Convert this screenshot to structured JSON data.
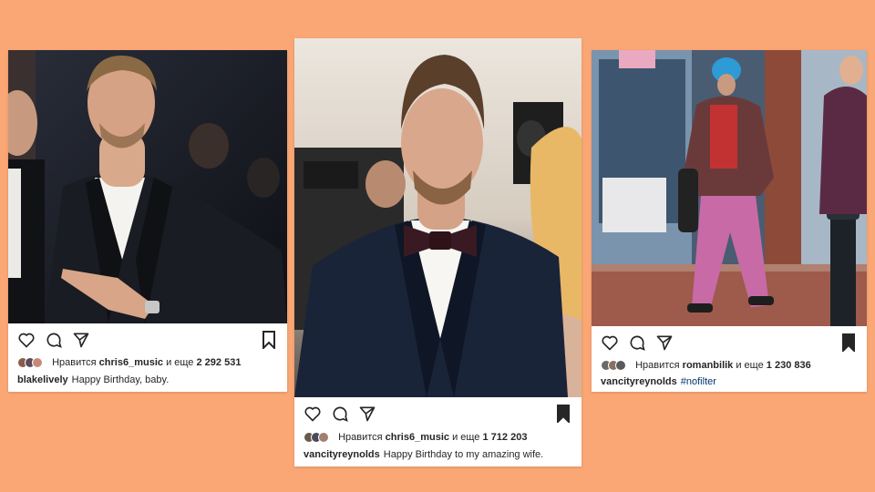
{
  "colors": {
    "background": "#FBA775",
    "card": "#FFFFFF",
    "text": "#262626",
    "hashtag": "#003569"
  },
  "icons": [
    "heart-icon",
    "comment-icon",
    "share-icon",
    "bookmark-icon"
  ],
  "posts": [
    {
      "likes_prefix": "Нравится",
      "liker": "chris6_music",
      "likes_middle": "и еще",
      "likes_count": "2 292 531",
      "author": "blakelively",
      "caption": "Happy Birthday, baby.",
      "hashtag": "",
      "bookmark_filled": false
    },
    {
      "likes_prefix": "Нравится",
      "liker": "chris6_music",
      "likes_middle": "и еще",
      "likes_count": "1 712 203",
      "author": "vancityreynolds",
      "caption": "Happy Birthday to my amazing wife.",
      "hashtag": "",
      "bookmark_filled": true
    },
    {
      "likes_prefix": "Нравится",
      "liker": "romanbilik",
      "likes_middle": "и еще",
      "likes_count": "1 230 836",
      "author": "vancityreynolds",
      "caption": "",
      "hashtag": "#nofilter",
      "bookmark_filled": true
    }
  ]
}
